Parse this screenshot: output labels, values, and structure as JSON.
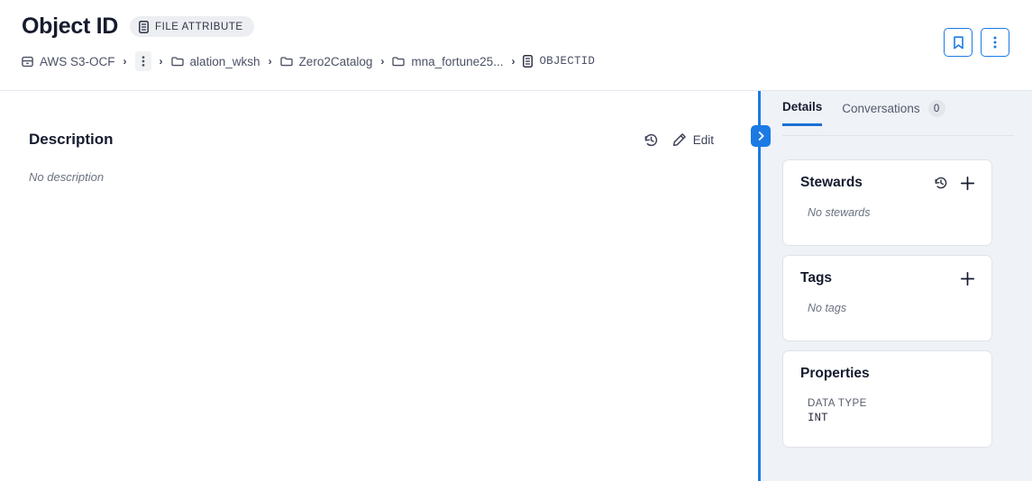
{
  "header": {
    "title": "Object ID",
    "badge": {
      "icon": "file-attribute-icon",
      "label": "FILE ATTRIBUTE"
    },
    "breadcrumb": [
      {
        "icon": "database-icon",
        "label": "AWS S3-OCF",
        "mono": false
      },
      {
        "icon": "ellipsis-vertical-icon",
        "label": "",
        "mono": false
      },
      {
        "icon": "folder-icon",
        "label": "alation_wksh",
        "mono": false
      },
      {
        "icon": "folder-icon",
        "label": "Zero2Catalog",
        "mono": false
      },
      {
        "icon": "folder-icon",
        "label": "mna_fortune25...",
        "mono": false
      },
      {
        "icon": "file-attribute-icon",
        "label": "OBJECTID",
        "mono": true
      }
    ],
    "separator": "›",
    "actions": [
      {
        "name": "bookmark-button",
        "icon": "bookmark-icon"
      },
      {
        "name": "more-options-button",
        "icon": "ellipsis-vertical-icon"
      }
    ]
  },
  "main": {
    "description": {
      "title": "Description",
      "history_icon": "history-icon",
      "edit_icon": "edit-pencil-icon",
      "edit_label": "Edit",
      "empty_text": "No description"
    }
  },
  "panel": {
    "toggle_icon": "chevron-right-icon",
    "tabs": [
      {
        "label": "Details",
        "count": null,
        "active": true
      },
      {
        "label": "Conversations",
        "count": "0",
        "active": false
      }
    ],
    "cards": [
      {
        "name": "stewards",
        "title": "Stewards",
        "icons": [
          "history-icon",
          "plus-icon"
        ],
        "empty_text": "No stewards"
      },
      {
        "name": "tags",
        "title": "Tags",
        "icons": [
          "plus-icon"
        ],
        "empty_text": "No tags"
      },
      {
        "name": "properties",
        "title": "Properties",
        "icons": [],
        "properties": [
          {
            "label": "DATA TYPE",
            "value": "INT"
          }
        ]
      }
    ]
  },
  "colors": {
    "accent_blue": "#1b7ae4",
    "tab_underline": "#1b6fd4",
    "panel_bg": "#eff2f6",
    "card_bg": "#ffffff",
    "card_border": "#dfe3e9",
    "title_ink": "#161b2e",
    "muted_ink": "#6b7280",
    "badge_bg": "#eceef1"
  }
}
